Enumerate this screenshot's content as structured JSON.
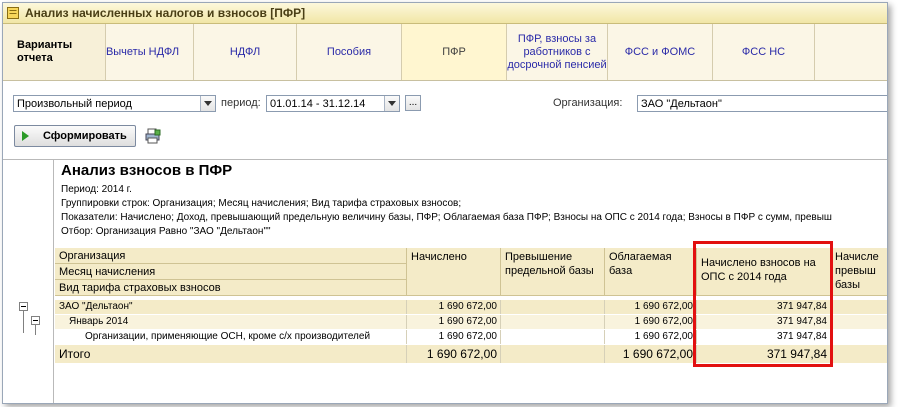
{
  "window": {
    "title": "Анализ начисленных налогов и взносов [ПФР]"
  },
  "tabs": [
    {
      "label": "Варианты отчета"
    },
    {
      "label": "Вычеты НДФЛ"
    },
    {
      "label": "НДФЛ"
    },
    {
      "label": "Пособия"
    },
    {
      "label": "ПФР"
    },
    {
      "label": "ПФР, взносы за работников с досрочной пенсией"
    },
    {
      "label": "ФСС и ФОМС"
    },
    {
      "label": "ФСС НС"
    }
  ],
  "filters": {
    "period_type": "Произвольный период",
    "period_label": "период:",
    "period_value": "01.01.14 - 31.12.14",
    "dots": "...",
    "org_label": "Организация:",
    "org_value": "ЗАО \"Дельтаон\""
  },
  "toolbar": {
    "generate_label": "Сформировать"
  },
  "report": {
    "title": "Анализ взносов в ПФР",
    "lines": [
      "Период: 2014 г.",
      "Группировки строк: Организация; Месяц начисления; Вид тарифа страховых взносов;",
      "Показатели: Начислено; Доход, превышающий предельную величину базы, ПФР; Облагаемая база ПФР; Взносы на ОПС с 2014 года; Взносы в ПФР с сумм, превыш",
      "Отбор: Организация Равно \"ЗАО \"Дельтаон\"\""
    ],
    "row_headers": [
      "Организация",
      "Месяц начисления",
      "Вид тарифа страховых взносов"
    ],
    "columns": [
      "Начислено",
      "Превышение предельной базы",
      "Облагаемая база",
      "Начислено взносов на ОПС с 2014 года",
      "Начисле превыш базы"
    ],
    "rows": [
      {
        "name": "ЗАО \"Дельтаон\"",
        "accrued": "1 690 672,00",
        "excess": "",
        "base": "1 690 672,00",
        "ops": "371 947,84"
      },
      {
        "name": "Январь 2014",
        "accrued": "1 690 672,00",
        "excess": "",
        "base": "1 690 672,00",
        "ops": "371 947,84"
      },
      {
        "name": "Организации, применяющие ОСН, кроме с/х производителей",
        "accrued": "1 690 672,00",
        "excess": "",
        "base": "1 690 672,00",
        "ops": "371 947,84"
      }
    ],
    "total": {
      "name": "Итого",
      "accrued": "1 690 672,00",
      "excess": "",
      "base": "1 690 672,00",
      "ops": "371 947,84"
    }
  }
}
